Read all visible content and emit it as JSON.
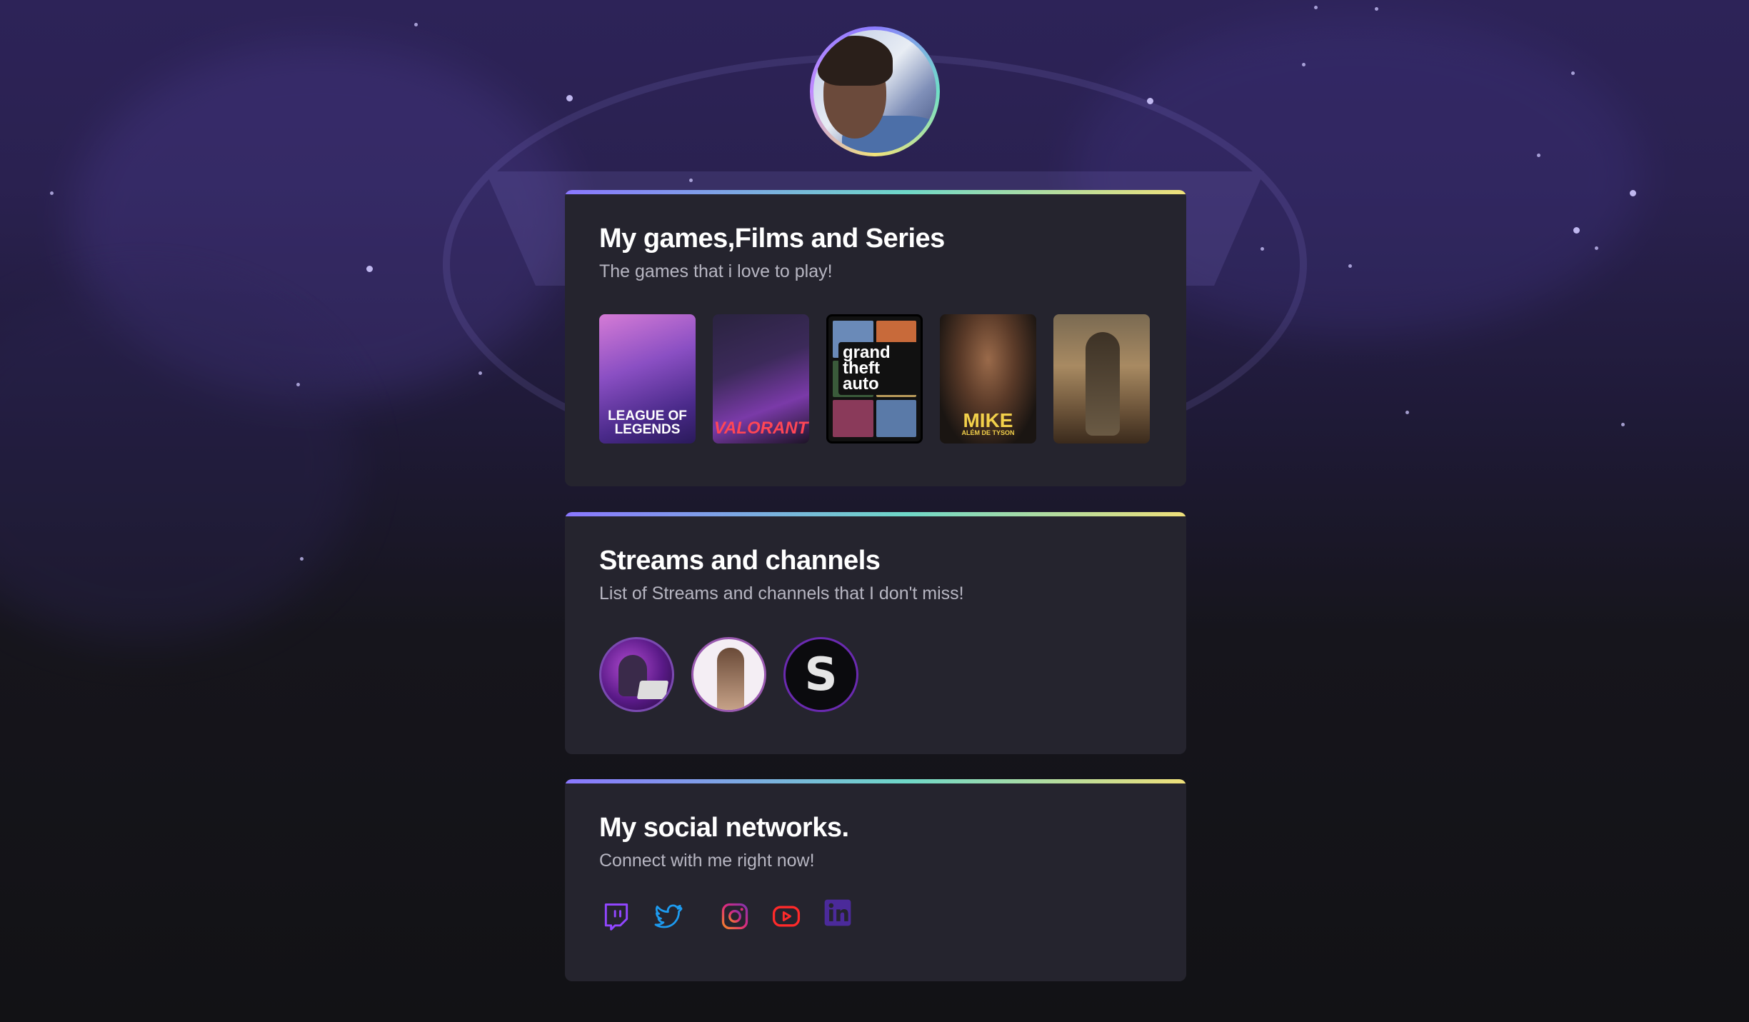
{
  "colors": {
    "accent_gradient": [
      "#8a77ff",
      "#6fd8c8",
      "#f0e07a"
    ],
    "card_bg": "#25242e",
    "text_muted": "#b7b6c2",
    "twitch": "#9146ff",
    "twitter": "#1d9bf0",
    "instagram": "#e1306c",
    "youtube": "#ff0000",
    "linkedin": "#4b2a9a"
  },
  "profile": {
    "avatar_icon": "profile-photo"
  },
  "games": {
    "title": "My games,Films and Series",
    "subtitle": "The games that i love to play!",
    "items": [
      {
        "label": "LEAGUE OF LEGENDS"
      },
      {
        "label": "VALORANT"
      },
      {
        "label": "grand theft auto"
      },
      {
        "label": "MIKE",
        "sublabel": "ALÉM DE TYSON"
      },
      {
        "label": ""
      }
    ]
  },
  "streams": {
    "title": "Streams and channels",
    "subtitle": "List of Streams and channels that I don't miss!",
    "items": [
      {
        "icon": "streamer-avatar"
      },
      {
        "icon": "fighter-avatar"
      },
      {
        "icon": "s-logo-avatar",
        "glyph": "S"
      }
    ]
  },
  "social": {
    "title": "My social networks.",
    "subtitle": "Connect with me right now!",
    "items": [
      {
        "icon": "twitch-icon"
      },
      {
        "icon": "twitter-icon"
      },
      {
        "icon": "instagram-icon"
      },
      {
        "icon": "youtube-icon"
      },
      {
        "icon": "linkedin-icon"
      }
    ]
  }
}
